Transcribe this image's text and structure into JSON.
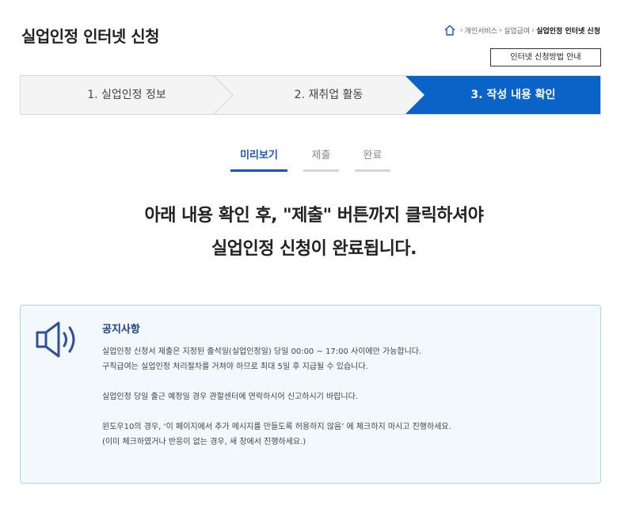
{
  "page": {
    "title": "실업인정 인터넷 신청"
  },
  "breadcrumb": {
    "items": [
      "개인서비스",
      "실업급여",
      "실업인정 인터넷 신청"
    ]
  },
  "guide_button": {
    "label": "인터넷 신청방법 안내"
  },
  "steps": [
    {
      "label": "1. 실업인정 정보",
      "active": false
    },
    {
      "label": "2. 재취업 활동",
      "active": false
    },
    {
      "label": "3. 작성 내용 확인",
      "active": true
    }
  ],
  "tabs": [
    {
      "label": "미리보기",
      "active": true
    },
    {
      "label": "제출",
      "active": false
    },
    {
      "label": "완료",
      "active": false
    }
  ],
  "headline": {
    "line1": "아래 내용 확인 후, \"제출\" 버튼까지 클릭하셔야",
    "line2": "실업인정 신청이 완료됩니다."
  },
  "notice": {
    "title": "공지사항",
    "lines": [
      "실업인정 신청서 제출은 지정된 출석일(실업인정일) 당일 00:00 ~ 17:00 사이에만 가능합니다.",
      "구직급여는 실업인정 처리절차를 거쳐야 하므로 최대 5일 후 지급될 수 있습니다.",
      "",
      "실업인정 당일 출근 예정일 경우 관할센터에 연락하시어 신고하시기 바랍니다.",
      "",
      "윈도우10의 경우, ‘이 페이지에서 추가 메시지를 만들도록 허용하지 않음’ 에 체크하지 마시고 진행하세요.",
      "(이미 체크하였거나 반응이 없는 경우, 새 창에서 진행하세요.)"
    ]
  },
  "colors": {
    "accent": "#0a64c8",
    "tab_active": "#1a56b8",
    "notice_title": "#1a3d8f",
    "notice_border": "#a9d6e0",
    "notice_bg": "#f3f8fc",
    "icon": "#2e4fa0"
  },
  "icons": {
    "home": "home-icon",
    "notice": "speaker-icon"
  }
}
